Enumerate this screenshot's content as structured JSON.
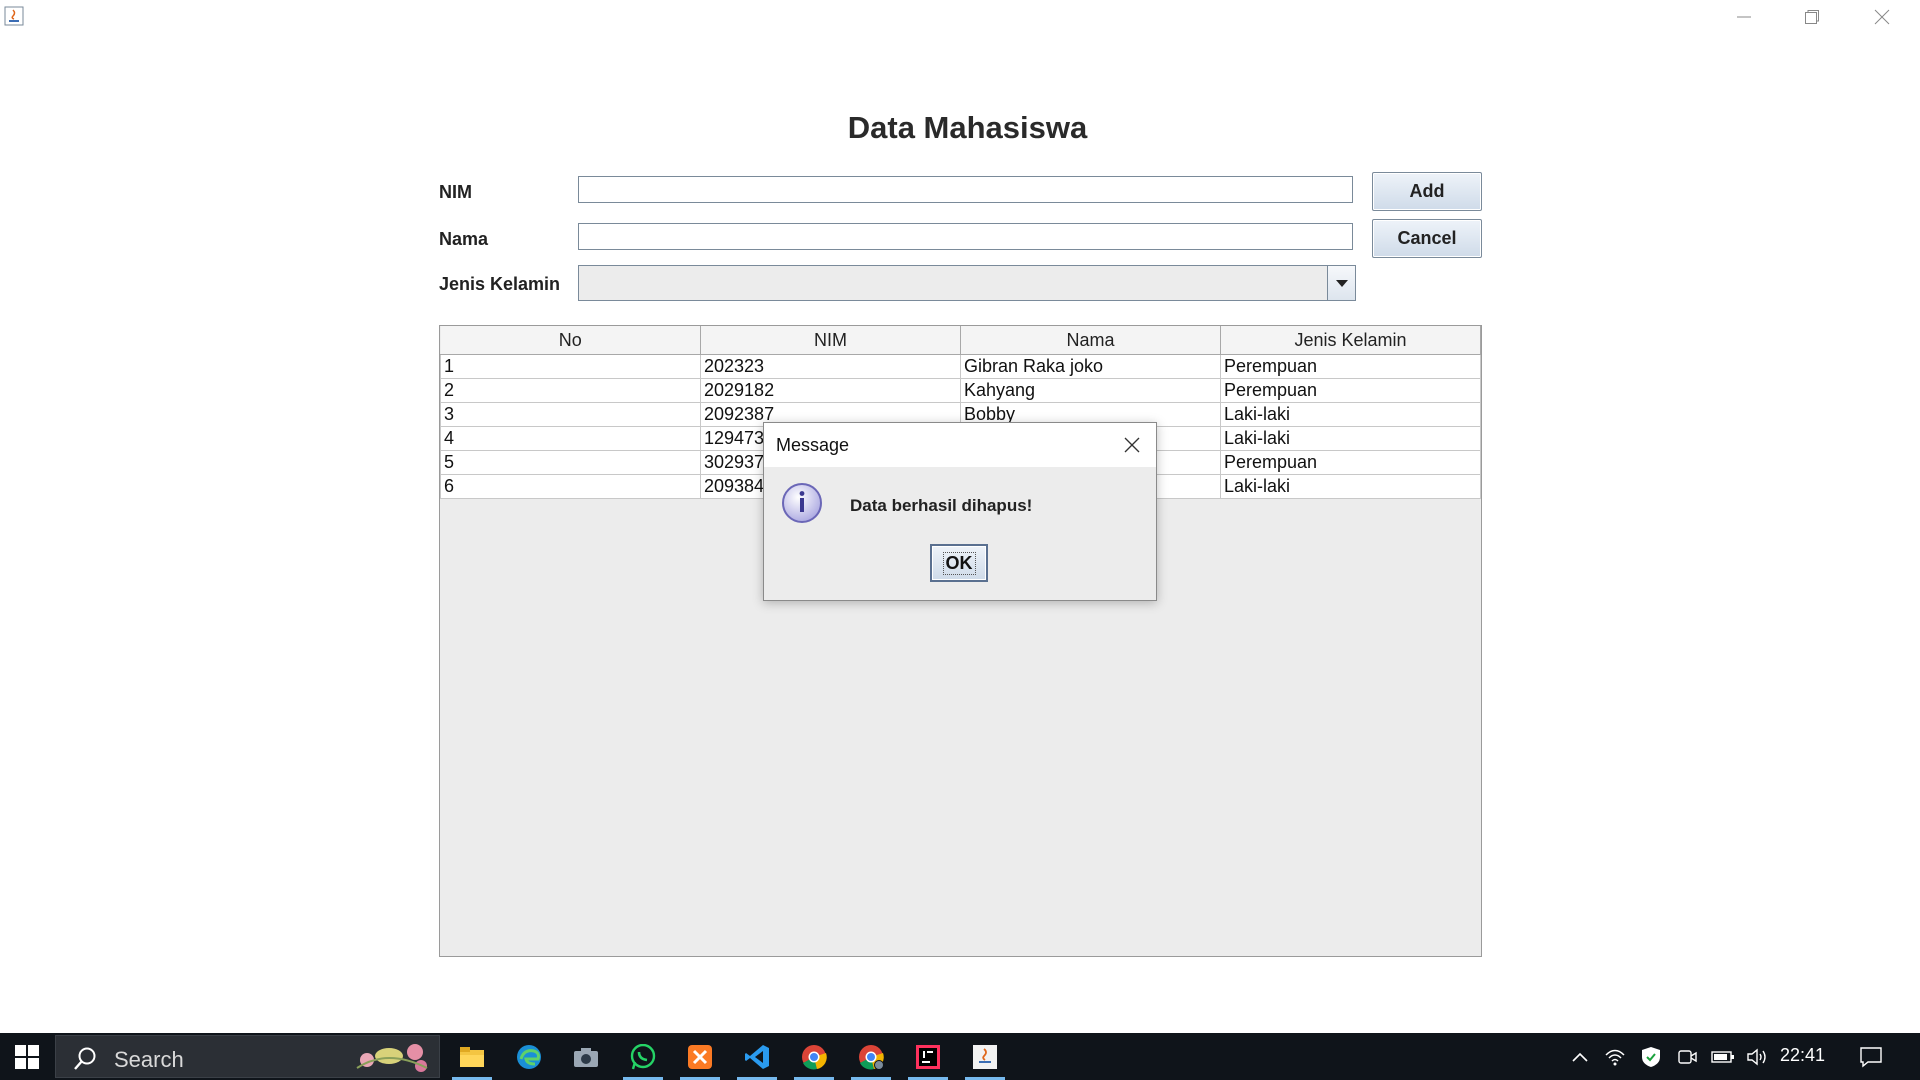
{
  "window": {
    "icon": "java-icon",
    "controls": [
      "minimize-icon",
      "maximize-icon",
      "close-icon"
    ]
  },
  "form": {
    "title": "Data Mahasiswa",
    "nim_label": "NIM",
    "nama_label": "Nama",
    "jenis_kelamin_label": "Jenis Kelamin",
    "nim_value": "",
    "nama_value": "",
    "jenis_kelamin_value": "",
    "add_label": "Add",
    "cancel_label": "Cancel"
  },
  "table": {
    "columns": [
      "No",
      "NIM",
      "Nama",
      "Jenis Kelamin"
    ],
    "rows": [
      [
        "1",
        "202323",
        "Gibran Raka joko",
        "Perempuan"
      ],
      [
        "2",
        "2029182",
        "Kahyang",
        "Perempuan"
      ],
      [
        "3",
        "2092387",
        "Bobby",
        "Laki-laki"
      ],
      [
        "4",
        "129473",
        "",
        "Laki-laki"
      ],
      [
        "5",
        "302937",
        "",
        "Perempuan"
      ],
      [
        "6",
        "209384",
        "",
        "Laki-laki"
      ]
    ]
  },
  "dialog": {
    "title": "Message",
    "message": "Data berhasil dihapus!",
    "ok_label": "OK",
    "icon": "info-icon"
  },
  "taskbar": {
    "search_placeholder": "Search",
    "apps": [
      "file-explorer-icon",
      "edge-icon",
      "camera-icon",
      "whatsapp-icon",
      "xampp-icon",
      "vscode-icon",
      "chrome-icon",
      "chrome-profile-icon",
      "intellij-icon",
      "java-icon"
    ],
    "time": "22:41"
  },
  "colors": {
    "accent": "#76b9ed",
    "taskbar": "#0f141a",
    "button_gradient_top": "#eef3f9",
    "button_gradient_bottom": "#cfdbe9"
  }
}
